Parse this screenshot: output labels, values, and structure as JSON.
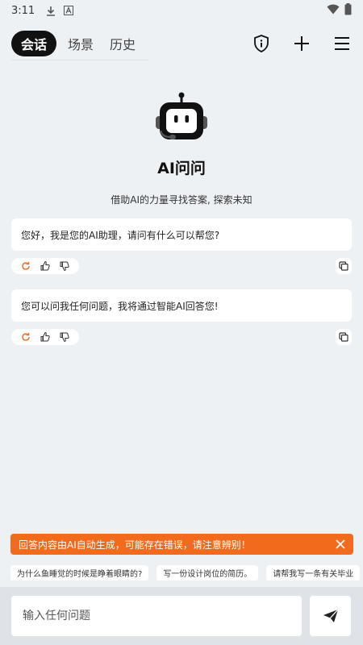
{
  "status_bar": {
    "time": "3:11"
  },
  "header": {
    "tabs": [
      {
        "label": "会话"
      },
      {
        "label": "场景"
      },
      {
        "label": "历史"
      }
    ]
  },
  "hero": {
    "title": "AI问问",
    "subtitle": "借助AI的力量寻找答案, 探索未知"
  },
  "messages": [
    {
      "text": "您好，我是您的AI助理，请问有什么可以帮您?"
    },
    {
      "text": "您可以问我任何问题，我将通过智能AI回答您!"
    }
  ],
  "notice": {
    "text": "回答内容由AI自动生成，可能存在错误，请注意辨别！"
  },
  "suggestions": [
    "为什么鱼睡觉的时候是睁着眼睛的?",
    "写一份设计岗位的简历。",
    "请帮我写一条有关毕业"
  ],
  "input": {
    "placeholder": "输入任何问题"
  },
  "colors": {
    "accent": "#f26b1d",
    "background": "#eef1f4",
    "tab_active_bg": "#111111"
  },
  "icons": [
    "download-icon",
    "font-icon",
    "wifi-icon",
    "battery-icon",
    "shield-info-icon",
    "plus-icon",
    "menu-icon",
    "robot-icon",
    "refresh-icon",
    "thumb-up-icon",
    "thumb-down-icon",
    "copy-icon",
    "close-icon",
    "send-icon"
  ]
}
